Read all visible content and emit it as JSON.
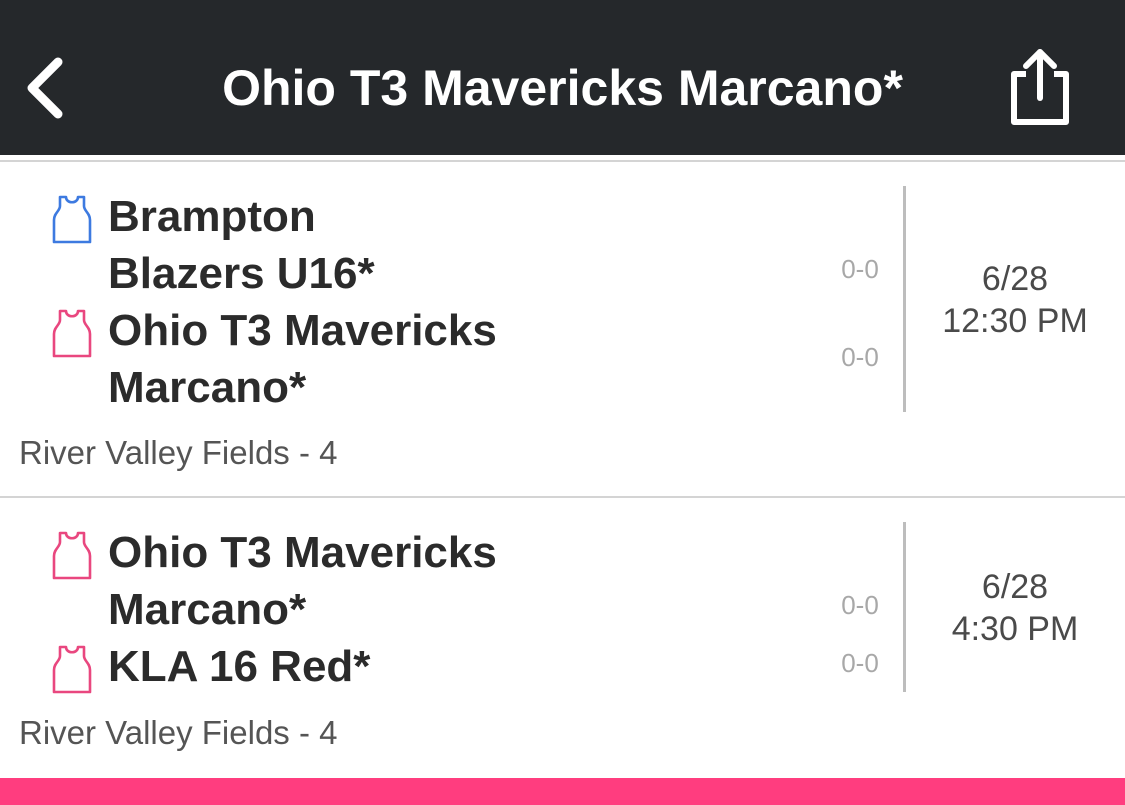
{
  "header": {
    "title": "Ohio T3 Mavericks Marcano*",
    "back_icon": "chevron-left-icon",
    "share_icon": "share-icon"
  },
  "colors": {
    "header_bg": "#25282b",
    "accent": "#ff3d7f",
    "home_jersey": "#3d7ae0",
    "away_jersey": "#e9477f"
  },
  "games": [
    {
      "teams": [
        {
          "name_line1": "Brampton",
          "name_line2": "Blazers U16*",
          "score": "0-0",
          "jersey": "blue-jersey-icon"
        },
        {
          "name_line1": "Ohio T3 Mavericks",
          "name_line2": "Marcano*",
          "score": "0-0",
          "jersey": "pink-jersey-icon"
        }
      ],
      "date": "6/28",
      "time": "12:30 PM",
      "location": "River Valley Fields - 4"
    },
    {
      "teams": [
        {
          "name_line1": "Ohio T3 Mavericks",
          "name_line2": "Marcano*",
          "score": "0-0",
          "jersey": "pink-jersey-icon"
        },
        {
          "name_line1": "KLA 16 Red*",
          "name_line2": "",
          "score": "0-0",
          "jersey": "pink-jersey-icon"
        }
      ],
      "date": "6/28",
      "time": "4:30 PM",
      "location": "River Valley Fields - 4"
    }
  ]
}
